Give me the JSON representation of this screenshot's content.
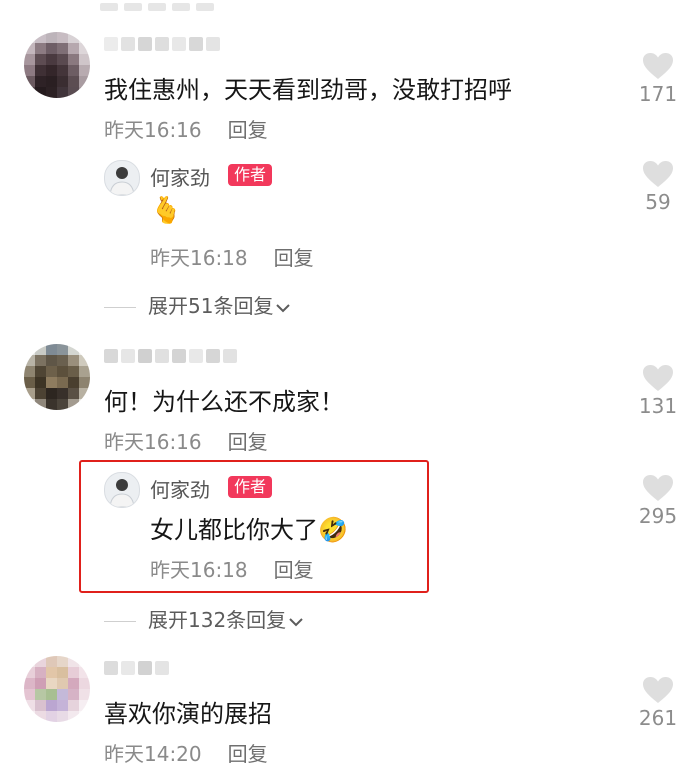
{
  "colors": {
    "author_badge_bg": "#f2385b",
    "highlight_border": "#e0201b",
    "meta_gray": "#8a8a8a",
    "like_icon_gray": "#dedede"
  },
  "comments": [
    {
      "text": "我住惠州，天天看到劲哥，没敢打招呼",
      "time": "昨天16:16",
      "reply_label": "回复",
      "likes": "171",
      "reply": {
        "name": "何家劲",
        "badge": "作者",
        "text": "🫰",
        "time": "昨天16:18",
        "reply_label": "回复",
        "likes": "59"
      },
      "expand": "展开51条回复"
    },
    {
      "text": "何！为什么还不成家！",
      "time": "昨天16:16",
      "reply_label": "回复",
      "likes": "131",
      "reply": {
        "name": "何家劲",
        "badge": "作者",
        "text": "女儿都比你大了🤣",
        "time": "昨天16:18",
        "reply_label": "回复",
        "likes": "295"
      },
      "expand": "展开132条回复"
    },
    {
      "text": "喜欢你演的展招",
      "time": "昨天14:20",
      "reply_label": "回复",
      "likes": "261"
    }
  ],
  "icons": {
    "like": "heart-icon",
    "expand": "chevron-down-icon"
  }
}
